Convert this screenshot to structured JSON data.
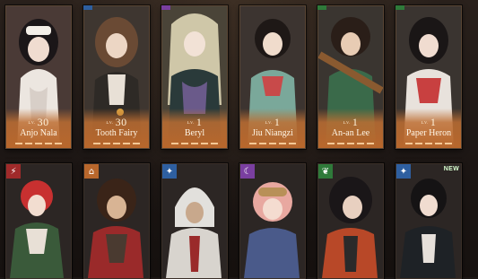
{
  "top_row": [
    {
      "level_prefix": "LV.",
      "level": "30",
      "name": "Anjo Nala",
      "badge_color": "#2e5fa0"
    },
    {
      "level_prefix": "LV.",
      "level": "30",
      "name": "Tooth Fairy",
      "badge_color": "#2e5fa0"
    },
    {
      "level_prefix": "LV.",
      "level": "1",
      "name": "Beryl",
      "badge_color": "#7a3fa0"
    },
    {
      "level_prefix": "LV.",
      "level": "1",
      "name": "Jiu Niangzi",
      "badge_color": "#7a3fa0"
    },
    {
      "level_prefix": "LV.",
      "level": "1",
      "name": "An-an Lee",
      "badge_color": "#2f7a3a"
    },
    {
      "level_prefix": "LV.",
      "level": "1",
      "name": "Paper Heron",
      "badge_color": "#2f7a3a"
    }
  ],
  "bottom_row": [
    {
      "badge_icon": "claw-icon",
      "badge_glyph": "⚡",
      "badge_color": "#a02a2a",
      "new": ""
    },
    {
      "badge_icon": "house-icon",
      "badge_glyph": "⌂",
      "badge_color": "#b8672c",
      "new": ""
    },
    {
      "badge_icon": "star-icon",
      "badge_glyph": "✦",
      "badge_color": "#2e5fa0",
      "new": ""
    },
    {
      "badge_icon": "moon-icon",
      "badge_glyph": "☾",
      "badge_color": "#7a3fa0",
      "new": ""
    },
    {
      "badge_icon": "leaf-icon",
      "badge_glyph": "❦",
      "badge_color": "#2f7a3a",
      "new": ""
    },
    {
      "badge_icon": "star-icon",
      "badge_glyph": "✦",
      "badge_color": "#2e5fa0",
      "new": "NEW"
    }
  ]
}
